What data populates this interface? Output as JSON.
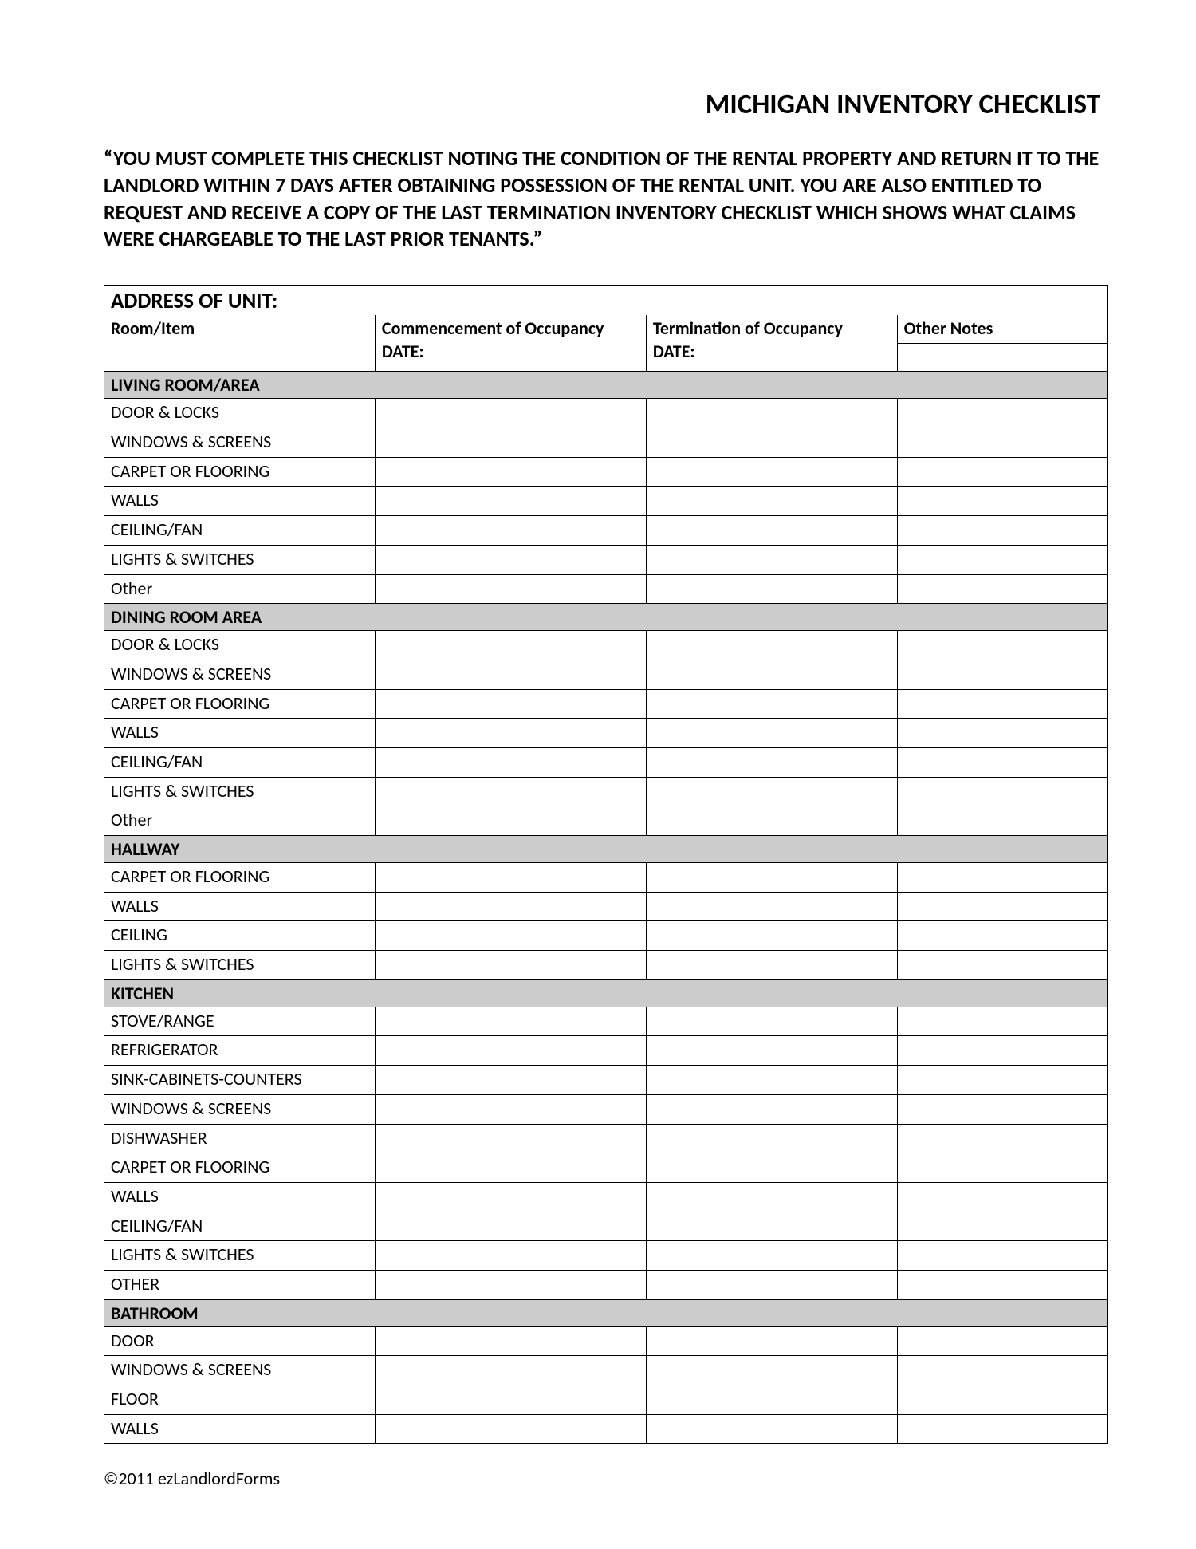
{
  "title": "MICHIGAN INVENTORY CHECKLIST",
  "instructions": "“YOU MUST COMPLETE THIS CHECKLIST NOTING THE CONDITION OF THE RENTAL PROPERTY AND RETURN IT TO THE LANDLORD WITHIN 7 DAYS AFTER OBTAINING POSSESSION OF THE RENTAL UNIT. YOU ARE ALSO ENTITLED TO REQUEST AND RECEIVE A COPY OF THE LAST TERMINATION INVENTORY CHECKLIST WHICH SHOWS WHAT CLAIMS WERE CHARGEABLE TO THE LAST PRIOR TENANTS.”",
  "address_label": "ADDRESS OF UNIT:",
  "columns": {
    "room": "Room/Item",
    "commencement_l1": "Commencement of Occupancy",
    "commencement_l2": "DATE:",
    "termination_l1": "Termination of Occupancy",
    "termination_l2": "DATE:",
    "notes": "Other Notes"
  },
  "sections": [
    {
      "heading": "LIVING ROOM/AREA",
      "items": [
        "DOOR & LOCKS",
        "WINDOWS & SCREENS",
        "CARPET OR FLOORING",
        "WALLS",
        "CEILING/FAN",
        "LIGHTS & SWITCHES",
        "Other"
      ]
    },
    {
      "heading": "DINING ROOM AREA",
      "items": [
        "DOOR & LOCKS",
        "WINDOWS & SCREENS",
        "CARPET OR FLOORING",
        "WALLS",
        "CEILING/FAN",
        "LIGHTS & SWITCHES",
        "Other"
      ]
    },
    {
      "heading": "HALLWAY",
      "items": [
        "CARPET OR FLOORING",
        "WALLS",
        "CEILING",
        "LIGHTS & SWITCHES"
      ]
    },
    {
      "heading": "KITCHEN",
      "items": [
        "STOVE/RANGE",
        "REFRIGERATOR",
        "SINK-CABINETS-COUNTERS",
        "WINDOWS & SCREENS",
        "DISHWASHER",
        "CARPET OR FLOORING",
        "WALLS",
        "CEILING/FAN",
        "LIGHTS & SWITCHES",
        "OTHER"
      ]
    },
    {
      "heading": "BATHROOM",
      "items": [
        "DOOR",
        "WINDOWS & SCREENS",
        "FLOOR",
        "WALLS"
      ]
    }
  ],
  "footer": "©2011 ezLandlordForms"
}
